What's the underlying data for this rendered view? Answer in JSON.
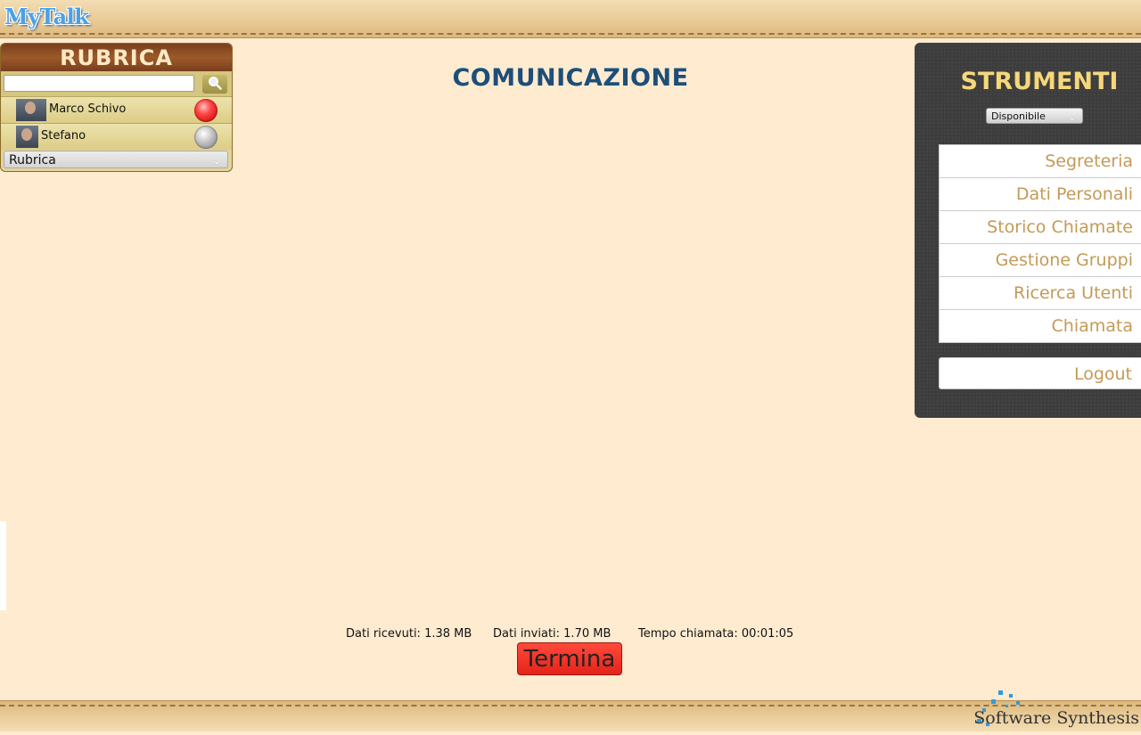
{
  "header": {
    "logo": "MyTalk"
  },
  "rubrica": {
    "title": "RUBRICA",
    "search": {
      "value": "",
      "placeholder": ""
    },
    "contacts": [
      {
        "name": "Marco Schivo",
        "status": "busy",
        "status_color": "#e82020"
      },
      {
        "name": "Stefano",
        "status": "offline",
        "status_color": "#aaaaaa"
      }
    ],
    "group_select": "Rubrica"
  },
  "main": {
    "title": "COMUNICAZIONE",
    "stats": {
      "received": "Dati ricevuti: 1.38 MB",
      "sent": "Dati inviati: 1.70 MB",
      "duration": "Tempo chiamata: 00:01:05"
    },
    "end_button": "Termina"
  },
  "strumenti": {
    "title": "STRUMENTI",
    "status_select": "Disponibile",
    "menu": [
      "Segreteria",
      "Dati Personali",
      "Storico Chiamate",
      "Gestione Gruppi",
      "Ricerca Utenti",
      "Chiamata"
    ],
    "logout": "Logout"
  },
  "footer": {
    "brand": "Software Synthesis"
  },
  "colors": {
    "background": "#feebd0",
    "title_blue": "#1d4e79",
    "menu_text": "#c49a55",
    "strumenti_title": "#f5d87a",
    "end_button": "#e5231a"
  }
}
